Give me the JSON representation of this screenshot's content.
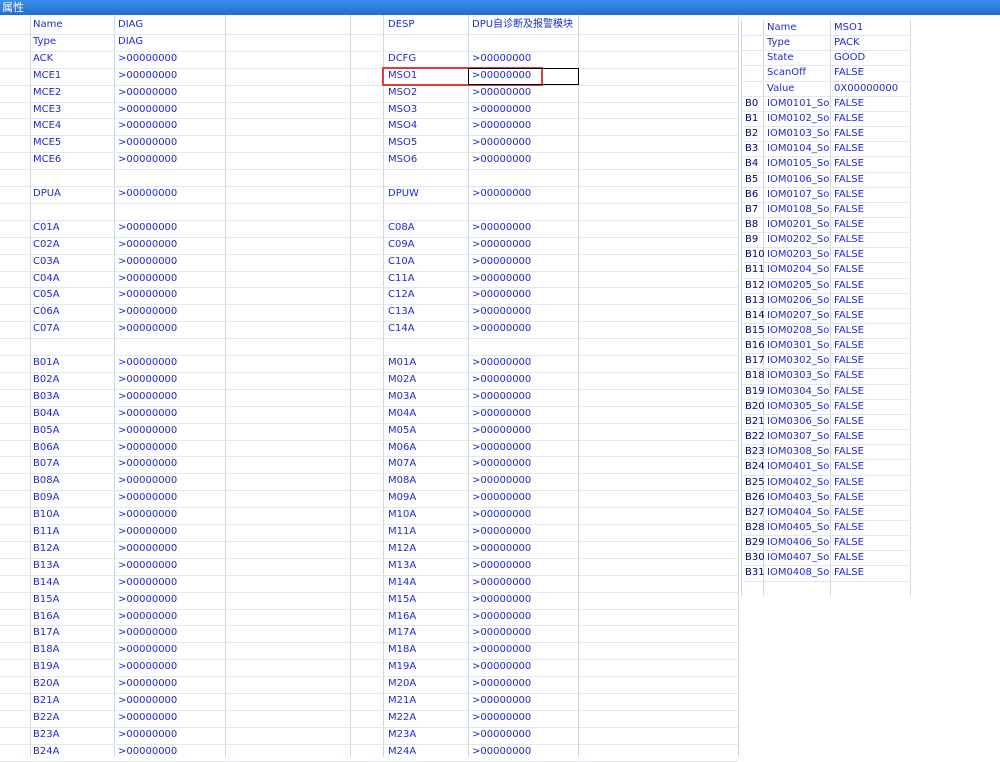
{
  "window": {
    "title": "属性"
  },
  "left_grid": {
    "rows": [
      [
        "Name",
        "DIAG",
        "DESP",
        "DPU自诊断及报警模块"
      ],
      [
        "Type",
        "DIAG",
        "",
        ""
      ],
      [
        "ACK",
        ">00000000",
        "DCFG",
        ">00000000"
      ],
      [
        "MCE1",
        ">00000000",
        "MSO1",
        ">00000000"
      ],
      [
        "MCE2",
        ">00000000",
        "MSO2",
        ">00000000"
      ],
      [
        "MCE3",
        ">00000000",
        "MSO3",
        ">00000000"
      ],
      [
        "MCE4",
        ">00000000",
        "MSO4",
        ">00000000"
      ],
      [
        "MCE5",
        ">00000000",
        "MSO5",
        ">00000000"
      ],
      [
        "MCE6",
        ">00000000",
        "MSO6",
        ">00000000"
      ],
      [
        "",
        "",
        "",
        ""
      ],
      [
        "DPUA",
        ">00000000",
        "DPUW",
        ">00000000"
      ],
      [
        "",
        "",
        "",
        ""
      ],
      [
        "C01A",
        ">00000000",
        "C08A",
        ">00000000"
      ],
      [
        "C02A",
        ">00000000",
        "C09A",
        ">00000000"
      ],
      [
        "C03A",
        ">00000000",
        "C10A",
        ">00000000"
      ],
      [
        "C04A",
        ">00000000",
        "C11A",
        ">00000000"
      ],
      [
        "C05A",
        ">00000000",
        "C12A",
        ">00000000"
      ],
      [
        "C06A",
        ">00000000",
        "C13A",
        ">00000000"
      ],
      [
        "C07A",
        ">00000000",
        "C14A",
        ">00000000"
      ],
      [
        "",
        "",
        "",
        ""
      ],
      [
        "B01A",
        ">00000000",
        "M01A",
        ">00000000"
      ],
      [
        "B02A",
        ">00000000",
        "M02A",
        ">00000000"
      ],
      [
        "B03A",
        ">00000000",
        "M03A",
        ">00000000"
      ],
      [
        "B04A",
        ">00000000",
        "M04A",
        ">00000000"
      ],
      [
        "B05A",
        ">00000000",
        "M05A",
        ">00000000"
      ],
      [
        "B06A",
        ">00000000",
        "M06A",
        ">00000000"
      ],
      [
        "B07A",
        ">00000000",
        "M07A",
        ">00000000"
      ],
      [
        "B08A",
        ">00000000",
        "M08A",
        ">00000000"
      ],
      [
        "B09A",
        ">00000000",
        "M09A",
        ">00000000"
      ],
      [
        "B10A",
        ">00000000",
        "M10A",
        ">00000000"
      ],
      [
        "B11A",
        ">00000000",
        "M11A",
        ">00000000"
      ],
      [
        "B12A",
        ">00000000",
        "M12A",
        ">00000000"
      ],
      [
        "B13A",
        ">00000000",
        "M13A",
        ">00000000"
      ],
      [
        "B14A",
        ">00000000",
        "M14A",
        ">00000000"
      ],
      [
        "B15A",
        ">00000000",
        "M15A",
        ">00000000"
      ],
      [
        "B16A",
        ">00000000",
        "M16A",
        ">00000000"
      ],
      [
        "B17A",
        ">00000000",
        "M17A",
        ">00000000"
      ],
      [
        "B18A",
        ">00000000",
        "M18A",
        ">00000000"
      ],
      [
        "B19A",
        ">00000000",
        "M19A",
        ">00000000"
      ],
      [
        "B20A",
        ">00000000",
        "M20A",
        ">00000000"
      ],
      [
        "B21A",
        ">00000000",
        "M21A",
        ">00000000"
      ],
      [
        "B22A",
        ">00000000",
        "M22A",
        ">00000000"
      ],
      [
        "B23A",
        ">00000000",
        "M23A",
        ">00000000"
      ],
      [
        "B24A",
        ">00000000",
        "M24A",
        ">00000000"
      ]
    ],
    "selected": "MSO1"
  },
  "right_grid": {
    "header_rows": [
      [
        "Name",
        "MSO1"
      ],
      [
        "Type",
        "PACK"
      ],
      [
        "State",
        "GOOD"
      ],
      [
        "ScanOff",
        "FALSE"
      ],
      [
        "Value",
        "0X00000000"
      ]
    ],
    "bit_rows": [
      [
        "B0",
        "IOM0101_So",
        "FALSE"
      ],
      [
        "B1",
        "IOM0102_So",
        "FALSE"
      ],
      [
        "B2",
        "IOM0103_So",
        "FALSE"
      ],
      [
        "B3",
        "IOM0104_So",
        "FALSE"
      ],
      [
        "B4",
        "IOM0105_So",
        "FALSE"
      ],
      [
        "B5",
        "IOM0106_So",
        "FALSE"
      ],
      [
        "B6",
        "IOM0107_So",
        "FALSE"
      ],
      [
        "B7",
        "IOM0108_So",
        "FALSE"
      ],
      [
        "B8",
        "IOM0201_So",
        "FALSE"
      ],
      [
        "B9",
        "IOM0202_So",
        "FALSE"
      ],
      [
        "B10",
        "IOM0203_So",
        "FALSE"
      ],
      [
        "B11",
        "IOM0204_So",
        "FALSE"
      ],
      [
        "B12",
        "IOM0205_So",
        "FALSE"
      ],
      [
        "B13",
        "IOM0206_So",
        "FALSE"
      ],
      [
        "B14",
        "IOM0207_So",
        "FALSE"
      ],
      [
        "B15",
        "IOM0208_So",
        "FALSE"
      ],
      [
        "B16",
        "IOM0301_So",
        "FALSE"
      ],
      [
        "B17",
        "IOM0302_So",
        "FALSE"
      ],
      [
        "B18",
        "IOM0303_So",
        "FALSE"
      ],
      [
        "B19",
        "IOM0304_So",
        "FALSE"
      ],
      [
        "B20",
        "IOM0305_So",
        "FALSE"
      ],
      [
        "B21",
        "IOM0306_So",
        "FALSE"
      ],
      [
        "B22",
        "IOM0307_So",
        "FALSE"
      ],
      [
        "B23",
        "IOM0308_So",
        "FALSE"
      ],
      [
        "B24",
        "IOM0401_So",
        "FALSE"
      ],
      [
        "B25",
        "IOM0402_So",
        "FALSE"
      ],
      [
        "B26",
        "IOM0403_So",
        "FALSE"
      ],
      [
        "B27",
        "IOM0404_So",
        "FALSE"
      ],
      [
        "B28",
        "IOM0405_So",
        "FALSE"
      ],
      [
        "B29",
        "IOM0406_So",
        "FALSE"
      ],
      [
        "B30",
        "IOM0407_So",
        "FALSE"
      ],
      [
        "B31",
        "IOM0408_So",
        "FALSE"
      ]
    ]
  },
  "colors": {
    "text": "#1d2bd0",
    "highlight": "#e33b3b",
    "titlebar": "#1f6fd1"
  }
}
